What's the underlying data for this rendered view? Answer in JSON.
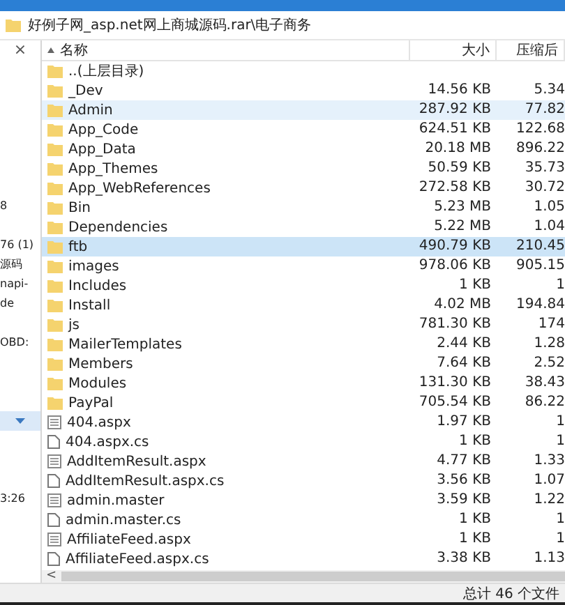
{
  "path_bar": {
    "path": "好例子网_asp.net网上商城源码.rar\\电子商务"
  },
  "left_panel": {
    "close": "×",
    "items": [
      "8",
      "76 (1)",
      "源码",
      "napi-",
      "de",
      "OBD:",
      "3:26"
    ],
    "dropdown": {
      "hovered": true
    }
  },
  "table": {
    "columns": [
      {
        "label": "名称",
        "sorted": true
      },
      {
        "label": "大小",
        "sorted": false
      },
      {
        "label": "压缩后",
        "sorted": false
      }
    ],
    "rows": [
      {
        "kind": "parent",
        "name": "..(上层目录)",
        "size": "",
        "packed": "",
        "selected": false,
        "hovered": false
      },
      {
        "kind": "folder",
        "name": "_Dev",
        "size": "14.56 KB",
        "packed": "5.34",
        "selected": false,
        "hovered": false
      },
      {
        "kind": "folder",
        "name": "Admin",
        "size": "287.92 KB",
        "packed": "77.82",
        "selected": false,
        "hovered": true
      },
      {
        "kind": "folder",
        "name": "App_Code",
        "size": "624.51 KB",
        "packed": "122.68",
        "selected": false,
        "hovered": false
      },
      {
        "kind": "folder",
        "name": "App_Data",
        "size": "20.18 MB",
        "packed": "896.22",
        "selected": false,
        "hovered": false
      },
      {
        "kind": "folder",
        "name": "App_Themes",
        "size": "50.59 KB",
        "packed": "35.73",
        "selected": false,
        "hovered": false
      },
      {
        "kind": "folder",
        "name": "App_WebReferences",
        "size": "272.58 KB",
        "packed": "30.72",
        "selected": false,
        "hovered": false
      },
      {
        "kind": "folder",
        "name": "Bin",
        "size": "5.23 MB",
        "packed": "1.05",
        "selected": false,
        "hovered": false
      },
      {
        "kind": "folder",
        "name": "Dependencies",
        "size": "5.22 MB",
        "packed": "1.04",
        "selected": false,
        "hovered": false
      },
      {
        "kind": "folder",
        "name": "ftb",
        "size": "490.79 KB",
        "packed": "210.45",
        "selected": true,
        "hovered": false
      },
      {
        "kind": "folder",
        "name": "images",
        "size": "978.06 KB",
        "packed": "905.15",
        "selected": false,
        "hovered": false
      },
      {
        "kind": "folder",
        "name": "Includes",
        "size": "1 KB",
        "packed": "1",
        "selected": false,
        "hovered": false
      },
      {
        "kind": "folder",
        "name": "Install",
        "size": "4.02 MB",
        "packed": "194.84",
        "selected": false,
        "hovered": false
      },
      {
        "kind": "folder",
        "name": "js",
        "size": "781.30 KB",
        "packed": "174",
        "selected": false,
        "hovered": false
      },
      {
        "kind": "folder",
        "name": "MailerTemplates",
        "size": "2.44 KB",
        "packed": "1.28",
        "selected": false,
        "hovered": false
      },
      {
        "kind": "folder",
        "name": "Members",
        "size": "7.64 KB",
        "packed": "2.52",
        "selected": false,
        "hovered": false
      },
      {
        "kind": "folder",
        "name": "Modules",
        "size": "131.30 KB",
        "packed": "38.43",
        "selected": false,
        "hovered": false
      },
      {
        "kind": "folder",
        "name": "PayPal",
        "size": "705.54 KB",
        "packed": "86.22",
        "selected": false,
        "hovered": false
      },
      {
        "kind": "page",
        "name": "404.aspx",
        "size": "1.97 KB",
        "packed": "1",
        "selected": false,
        "hovered": false
      },
      {
        "kind": "code",
        "name": "404.aspx.cs",
        "size": "1 KB",
        "packed": "1",
        "selected": false,
        "hovered": false
      },
      {
        "kind": "page",
        "name": "AddItemResult.aspx",
        "size": "4.77 KB",
        "packed": "1.33",
        "selected": false,
        "hovered": false
      },
      {
        "kind": "code",
        "name": "AddItemResult.aspx.cs",
        "size": "3.56 KB",
        "packed": "1.07",
        "selected": false,
        "hovered": false
      },
      {
        "kind": "page",
        "name": "admin.master",
        "size": "3.59 KB",
        "packed": "1.22",
        "selected": false,
        "hovered": false
      },
      {
        "kind": "code",
        "name": "admin.master.cs",
        "size": "1 KB",
        "packed": "1",
        "selected": false,
        "hovered": false
      },
      {
        "kind": "page",
        "name": "AffiliateFeed.aspx",
        "size": "1 KB",
        "packed": "1",
        "selected": false,
        "hovered": false
      },
      {
        "kind": "code",
        "name": "AffiliateFeed.aspx.cs",
        "size": "3.38 KB",
        "packed": "1.13",
        "selected": false,
        "hovered": false
      }
    ]
  },
  "scrollbar": {
    "left_arrow": "<"
  },
  "status_bar": {
    "summary": "总计 46 个文件"
  }
}
